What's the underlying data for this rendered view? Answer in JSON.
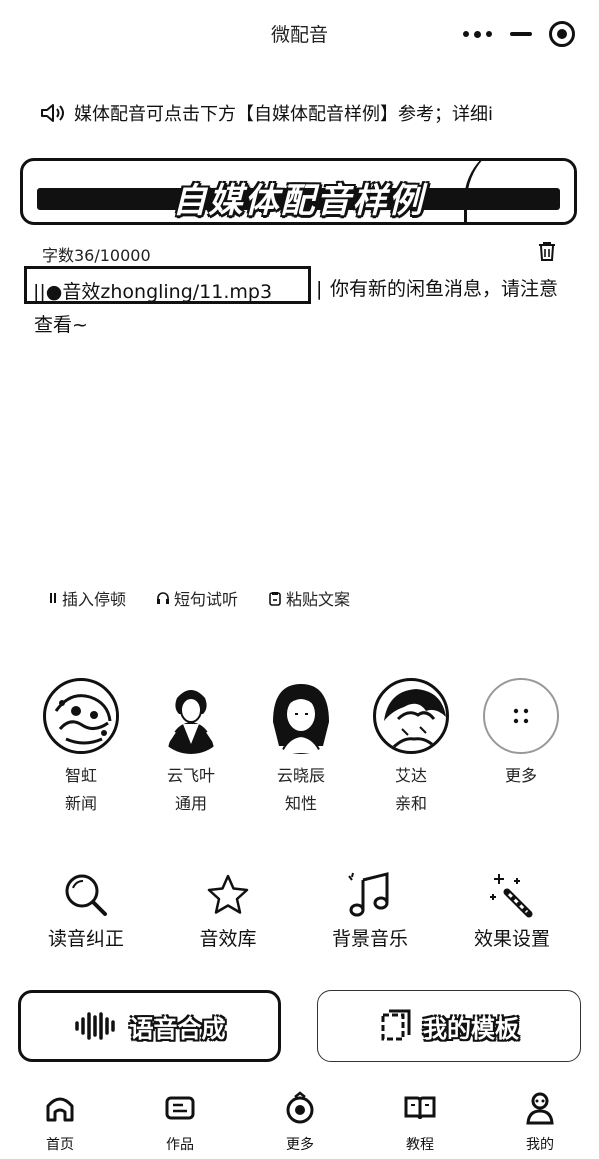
{
  "titlebar": {
    "title": "微配音"
  },
  "notice": {
    "text": "媒体配音可点击下方【自媒体配音样例】参考；详细i"
  },
  "banner": {
    "text": "自媒体配音样例"
  },
  "editor": {
    "word_count": "字数36/10000",
    "tag": "||●音效zhongling/11.mp3",
    "tag_end": "|",
    "text_line1": "你有新的闲鱼消息，请注意",
    "text_line2": "查看~"
  },
  "tools": [
    {
      "icon": "pause-icon",
      "label": "插入停顿"
    },
    {
      "icon": "headphones-icon",
      "label": "短句试听"
    },
    {
      "icon": "paste-icon",
      "label": "粘贴文案"
    }
  ],
  "voices": [
    {
      "name": "智虹",
      "style": "新闻",
      "icon": "avatar-zhihong"
    },
    {
      "name": "云飞叶",
      "style": "通用",
      "icon": "avatar-yunfeiye"
    },
    {
      "name": "云晓辰",
      "style": "知性",
      "icon": "avatar-yunxiaochen"
    },
    {
      "name": "艾达",
      "style": "亲和",
      "icon": "avatar-aida"
    },
    {
      "name": "更多",
      "style": "",
      "icon": "more-icon"
    }
  ],
  "features": [
    {
      "icon": "magnifier-icon",
      "label": "读音纠正"
    },
    {
      "icon": "star-icon",
      "label": "音效库"
    },
    {
      "icon": "music-note-icon",
      "label": "背景音乐"
    },
    {
      "icon": "magic-wand-icon",
      "label": "效果设置"
    }
  ],
  "actions": {
    "synthesize": "语音合成",
    "templates": "我的模板"
  },
  "tabbar": [
    {
      "icon": "home-icon",
      "label": "首页"
    },
    {
      "icon": "works-icon",
      "label": "作品"
    },
    {
      "icon": "more-circle-icon",
      "label": "更多"
    },
    {
      "icon": "book-icon",
      "label": "教程"
    },
    {
      "icon": "user-icon",
      "label": "我的"
    }
  ]
}
